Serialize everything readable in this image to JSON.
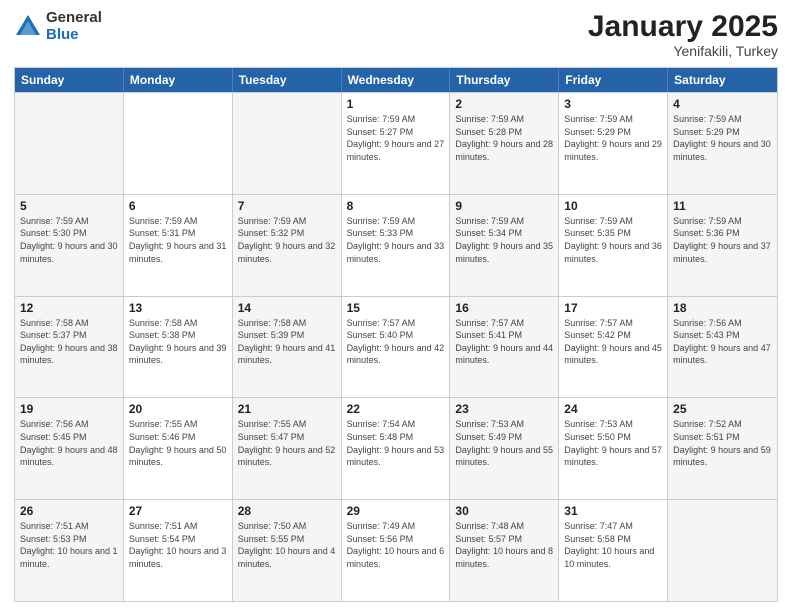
{
  "logo": {
    "general": "General",
    "blue": "Blue"
  },
  "title": "January 2025",
  "location": "Yenifakili, Turkey",
  "days": [
    "Sunday",
    "Monday",
    "Tuesday",
    "Wednesday",
    "Thursday",
    "Friday",
    "Saturday"
  ],
  "weeks": [
    [
      {
        "day": "",
        "detail": ""
      },
      {
        "day": "",
        "detail": ""
      },
      {
        "day": "",
        "detail": ""
      },
      {
        "day": "1",
        "detail": "Sunrise: 7:59 AM\nSunset: 5:27 PM\nDaylight: 9 hours\nand 27 minutes."
      },
      {
        "day": "2",
        "detail": "Sunrise: 7:59 AM\nSunset: 5:28 PM\nDaylight: 9 hours\nand 28 minutes."
      },
      {
        "day": "3",
        "detail": "Sunrise: 7:59 AM\nSunset: 5:29 PM\nDaylight: 9 hours\nand 29 minutes."
      },
      {
        "day": "4",
        "detail": "Sunrise: 7:59 AM\nSunset: 5:29 PM\nDaylight: 9 hours\nand 30 minutes."
      }
    ],
    [
      {
        "day": "5",
        "detail": "Sunrise: 7:59 AM\nSunset: 5:30 PM\nDaylight: 9 hours\nand 30 minutes."
      },
      {
        "day": "6",
        "detail": "Sunrise: 7:59 AM\nSunset: 5:31 PM\nDaylight: 9 hours\nand 31 minutes."
      },
      {
        "day": "7",
        "detail": "Sunrise: 7:59 AM\nSunset: 5:32 PM\nDaylight: 9 hours\nand 32 minutes."
      },
      {
        "day": "8",
        "detail": "Sunrise: 7:59 AM\nSunset: 5:33 PM\nDaylight: 9 hours\nand 33 minutes."
      },
      {
        "day": "9",
        "detail": "Sunrise: 7:59 AM\nSunset: 5:34 PM\nDaylight: 9 hours\nand 35 minutes."
      },
      {
        "day": "10",
        "detail": "Sunrise: 7:59 AM\nSunset: 5:35 PM\nDaylight: 9 hours\nand 36 minutes."
      },
      {
        "day": "11",
        "detail": "Sunrise: 7:59 AM\nSunset: 5:36 PM\nDaylight: 9 hours\nand 37 minutes."
      }
    ],
    [
      {
        "day": "12",
        "detail": "Sunrise: 7:58 AM\nSunset: 5:37 PM\nDaylight: 9 hours\nand 38 minutes."
      },
      {
        "day": "13",
        "detail": "Sunrise: 7:58 AM\nSunset: 5:38 PM\nDaylight: 9 hours\nand 39 minutes."
      },
      {
        "day": "14",
        "detail": "Sunrise: 7:58 AM\nSunset: 5:39 PM\nDaylight: 9 hours\nand 41 minutes."
      },
      {
        "day": "15",
        "detail": "Sunrise: 7:57 AM\nSunset: 5:40 PM\nDaylight: 9 hours\nand 42 minutes."
      },
      {
        "day": "16",
        "detail": "Sunrise: 7:57 AM\nSunset: 5:41 PM\nDaylight: 9 hours\nand 44 minutes."
      },
      {
        "day": "17",
        "detail": "Sunrise: 7:57 AM\nSunset: 5:42 PM\nDaylight: 9 hours\nand 45 minutes."
      },
      {
        "day": "18",
        "detail": "Sunrise: 7:56 AM\nSunset: 5:43 PM\nDaylight: 9 hours\nand 47 minutes."
      }
    ],
    [
      {
        "day": "19",
        "detail": "Sunrise: 7:56 AM\nSunset: 5:45 PM\nDaylight: 9 hours\nand 48 minutes."
      },
      {
        "day": "20",
        "detail": "Sunrise: 7:55 AM\nSunset: 5:46 PM\nDaylight: 9 hours\nand 50 minutes."
      },
      {
        "day": "21",
        "detail": "Sunrise: 7:55 AM\nSunset: 5:47 PM\nDaylight: 9 hours\nand 52 minutes."
      },
      {
        "day": "22",
        "detail": "Sunrise: 7:54 AM\nSunset: 5:48 PM\nDaylight: 9 hours\nand 53 minutes."
      },
      {
        "day": "23",
        "detail": "Sunrise: 7:53 AM\nSunset: 5:49 PM\nDaylight: 9 hours\nand 55 minutes."
      },
      {
        "day": "24",
        "detail": "Sunrise: 7:53 AM\nSunset: 5:50 PM\nDaylight: 9 hours\nand 57 minutes."
      },
      {
        "day": "25",
        "detail": "Sunrise: 7:52 AM\nSunset: 5:51 PM\nDaylight: 9 hours\nand 59 minutes."
      }
    ],
    [
      {
        "day": "26",
        "detail": "Sunrise: 7:51 AM\nSunset: 5:53 PM\nDaylight: 10 hours\nand 1 minute."
      },
      {
        "day": "27",
        "detail": "Sunrise: 7:51 AM\nSunset: 5:54 PM\nDaylight: 10 hours\nand 3 minutes."
      },
      {
        "day": "28",
        "detail": "Sunrise: 7:50 AM\nSunset: 5:55 PM\nDaylight: 10 hours\nand 4 minutes."
      },
      {
        "day": "29",
        "detail": "Sunrise: 7:49 AM\nSunset: 5:56 PM\nDaylight: 10 hours\nand 6 minutes."
      },
      {
        "day": "30",
        "detail": "Sunrise: 7:48 AM\nSunset: 5:57 PM\nDaylight: 10 hours\nand 8 minutes."
      },
      {
        "day": "31",
        "detail": "Sunrise: 7:47 AM\nSunset: 5:58 PM\nDaylight: 10 hours\nand 10 minutes."
      },
      {
        "day": "",
        "detail": ""
      }
    ]
  ]
}
